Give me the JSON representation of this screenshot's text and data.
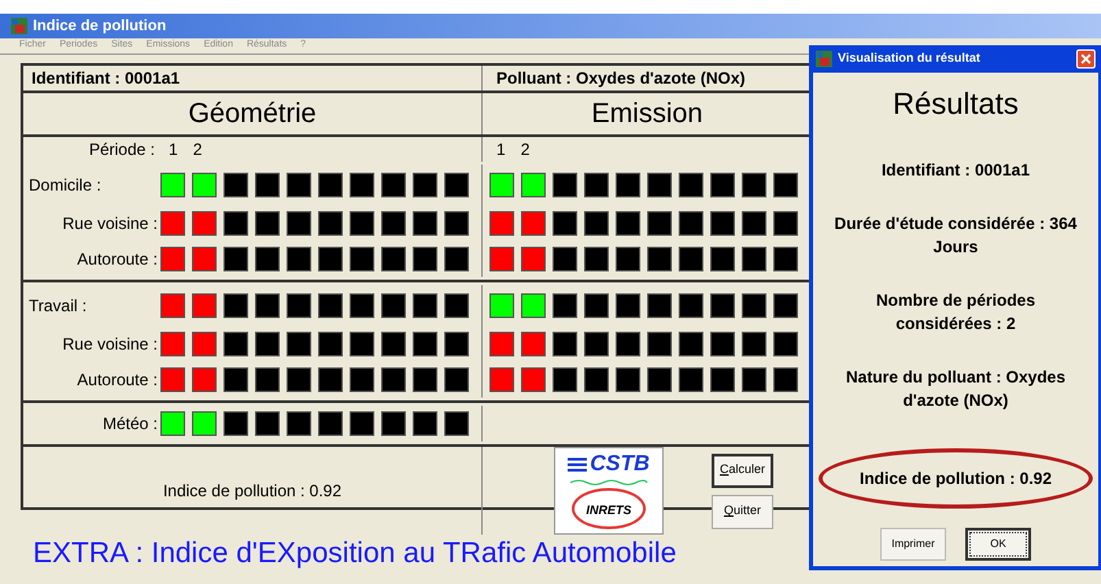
{
  "window": {
    "title": "Indice de pollution"
  },
  "menu": [
    "Ficher",
    "Periodes",
    "Sites",
    "Emissions",
    "Edition",
    "Résultats",
    "?"
  ],
  "header": {
    "identifiant": "Identifiant : 0001a1",
    "polluant": "Polluant : Oxydes d'azote (NOx)"
  },
  "geometry_title": "Géométrie",
  "emission_title": "Emission",
  "periods": {
    "label": "Période :",
    "geometry": [
      "1",
      "2"
    ],
    "emission": [
      "1",
      "2"
    ]
  },
  "groups": [
    {
      "rows": [
        {
          "kind": "main",
          "label": "Domicile :",
          "geometry": [
            {
              "color": "#00ff00"
            },
            {
              "color": "#00ff00"
            },
            {
              "color": "#000000"
            },
            {
              "color": "#000000"
            },
            {
              "color": "#000000"
            },
            {
              "color": "#000000"
            },
            {
              "color": "#000000"
            },
            {
              "color": "#000000"
            },
            {
              "color": "#000000"
            },
            {
              "color": "#000000"
            }
          ],
          "emission": [
            {
              "color": "#00ff00"
            },
            {
              "color": "#00ff00"
            },
            {
              "color": "#000000"
            },
            {
              "color": "#000000"
            },
            {
              "color": "#000000"
            },
            {
              "color": "#000000"
            },
            {
              "color": "#000000"
            },
            {
              "color": "#000000"
            },
            {
              "color": "#000000"
            },
            {
              "color": "#000000"
            }
          ]
        },
        {
          "kind": "sub",
          "label": "Rue voisine :",
          "geometry": [
            {
              "color": "#ff0000"
            },
            {
              "color": "#ff0000"
            },
            {
              "color": "#000000"
            },
            {
              "color": "#000000"
            },
            {
              "color": "#000000"
            },
            {
              "color": "#000000"
            },
            {
              "color": "#000000"
            },
            {
              "color": "#000000"
            },
            {
              "color": "#000000"
            },
            {
              "color": "#000000"
            }
          ],
          "emission": [
            {
              "color": "#ff0000"
            },
            {
              "color": "#ff0000"
            },
            {
              "color": "#000000"
            },
            {
              "color": "#000000"
            },
            {
              "color": "#000000"
            },
            {
              "color": "#000000"
            },
            {
              "color": "#000000"
            },
            {
              "color": "#000000"
            },
            {
              "color": "#000000"
            },
            {
              "color": "#000000"
            }
          ]
        },
        {
          "kind": "sub",
          "label": "Autoroute :",
          "geometry": [
            {
              "color": "#ff0000"
            },
            {
              "color": "#ff0000"
            },
            {
              "color": "#000000"
            },
            {
              "color": "#000000"
            },
            {
              "color": "#000000"
            },
            {
              "color": "#000000"
            },
            {
              "color": "#000000"
            },
            {
              "color": "#000000"
            },
            {
              "color": "#000000"
            },
            {
              "color": "#000000"
            }
          ],
          "emission": [
            {
              "color": "#ff0000"
            },
            {
              "color": "#ff0000"
            },
            {
              "color": "#000000"
            },
            {
              "color": "#000000"
            },
            {
              "color": "#000000"
            },
            {
              "color": "#000000"
            },
            {
              "color": "#000000"
            },
            {
              "color": "#000000"
            },
            {
              "color": "#000000"
            },
            {
              "color": "#000000"
            }
          ]
        }
      ]
    },
    {
      "rows": [
        {
          "kind": "main",
          "label": "Travail :",
          "geometry": [
            {
              "color": "#ff0000"
            },
            {
              "color": "#ff0000"
            },
            {
              "color": "#000000"
            },
            {
              "color": "#000000"
            },
            {
              "color": "#000000"
            },
            {
              "color": "#000000"
            },
            {
              "color": "#000000"
            },
            {
              "color": "#000000"
            },
            {
              "color": "#000000"
            },
            {
              "color": "#000000"
            }
          ],
          "emission": [
            {
              "color": "#00ff00"
            },
            {
              "color": "#00ff00"
            },
            {
              "color": "#000000"
            },
            {
              "color": "#000000"
            },
            {
              "color": "#000000"
            },
            {
              "color": "#000000"
            },
            {
              "color": "#000000"
            },
            {
              "color": "#000000"
            },
            {
              "color": "#000000"
            },
            {
              "color": "#000000"
            }
          ]
        },
        {
          "kind": "sub",
          "label": "Rue voisine :",
          "geometry": [
            {
              "color": "#ff0000"
            },
            {
              "color": "#ff0000"
            },
            {
              "color": "#000000"
            },
            {
              "color": "#000000"
            },
            {
              "color": "#000000"
            },
            {
              "color": "#000000"
            },
            {
              "color": "#000000"
            },
            {
              "color": "#000000"
            },
            {
              "color": "#000000"
            },
            {
              "color": "#000000"
            }
          ],
          "emission": [
            {
              "color": "#ff0000"
            },
            {
              "color": "#ff0000"
            },
            {
              "color": "#000000"
            },
            {
              "color": "#000000"
            },
            {
              "color": "#000000"
            },
            {
              "color": "#000000"
            },
            {
              "color": "#000000"
            },
            {
              "color": "#000000"
            },
            {
              "color": "#000000"
            },
            {
              "color": "#000000"
            }
          ]
        },
        {
          "kind": "sub",
          "label": "Autoroute :",
          "geometry": [
            {
              "color": "#ff0000"
            },
            {
              "color": "#ff0000"
            },
            {
              "color": "#000000"
            },
            {
              "color": "#000000"
            },
            {
              "color": "#000000"
            },
            {
              "color": "#000000"
            },
            {
              "color": "#000000"
            },
            {
              "color": "#000000"
            },
            {
              "color": "#000000"
            },
            {
              "color": "#000000"
            }
          ],
          "emission": [
            {
              "color": "#ff0000"
            },
            {
              "color": "#ff0000"
            },
            {
              "color": "#000000"
            },
            {
              "color": "#000000"
            },
            {
              "color": "#000000"
            },
            {
              "color": "#000000"
            },
            {
              "color": "#000000"
            },
            {
              "color": "#000000"
            },
            {
              "color": "#000000"
            },
            {
              "color": "#000000"
            }
          ]
        }
      ]
    },
    {
      "rows": [
        {
          "kind": "sub",
          "label": "Météo :",
          "geometry": [
            {
              "color": "#00ff00"
            },
            {
              "color": "#00ff00"
            },
            {
              "color": "#000000"
            },
            {
              "color": "#000000"
            },
            {
              "color": "#000000"
            },
            {
              "color": "#000000"
            },
            {
              "color": "#000000"
            },
            {
              "color": "#000000"
            },
            {
              "color": "#000000"
            },
            {
              "color": "#000000"
            }
          ]
        }
      ]
    }
  ],
  "indice": "Indice de pollution : 0.92",
  "logos": {
    "top": "CSTB",
    "bottom": "INRETS"
  },
  "buttons": [
    {
      "label": "Calculer",
      "default": true
    },
    {
      "label": "Quitter",
      "default": false
    }
  ],
  "footer": "EXTRA : Indice d'EXposition au TRafic Automobile",
  "dialog": {
    "title": "Visualisation du résultat",
    "heading": "Résultats",
    "lines": [
      "Identifiant : 0001a1",
      "Durée d'étude considérée : 364 Jours",
      "Nombre de périodes considérées : 2",
      "Nature du polluant : Oxydes d'azote (NOx)"
    ],
    "result": "Indice de pollution : 0.92",
    "buttons": [
      {
        "label": "Imprimer",
        "focused": false
      },
      {
        "label": "OK",
        "focused": true
      }
    ]
  }
}
